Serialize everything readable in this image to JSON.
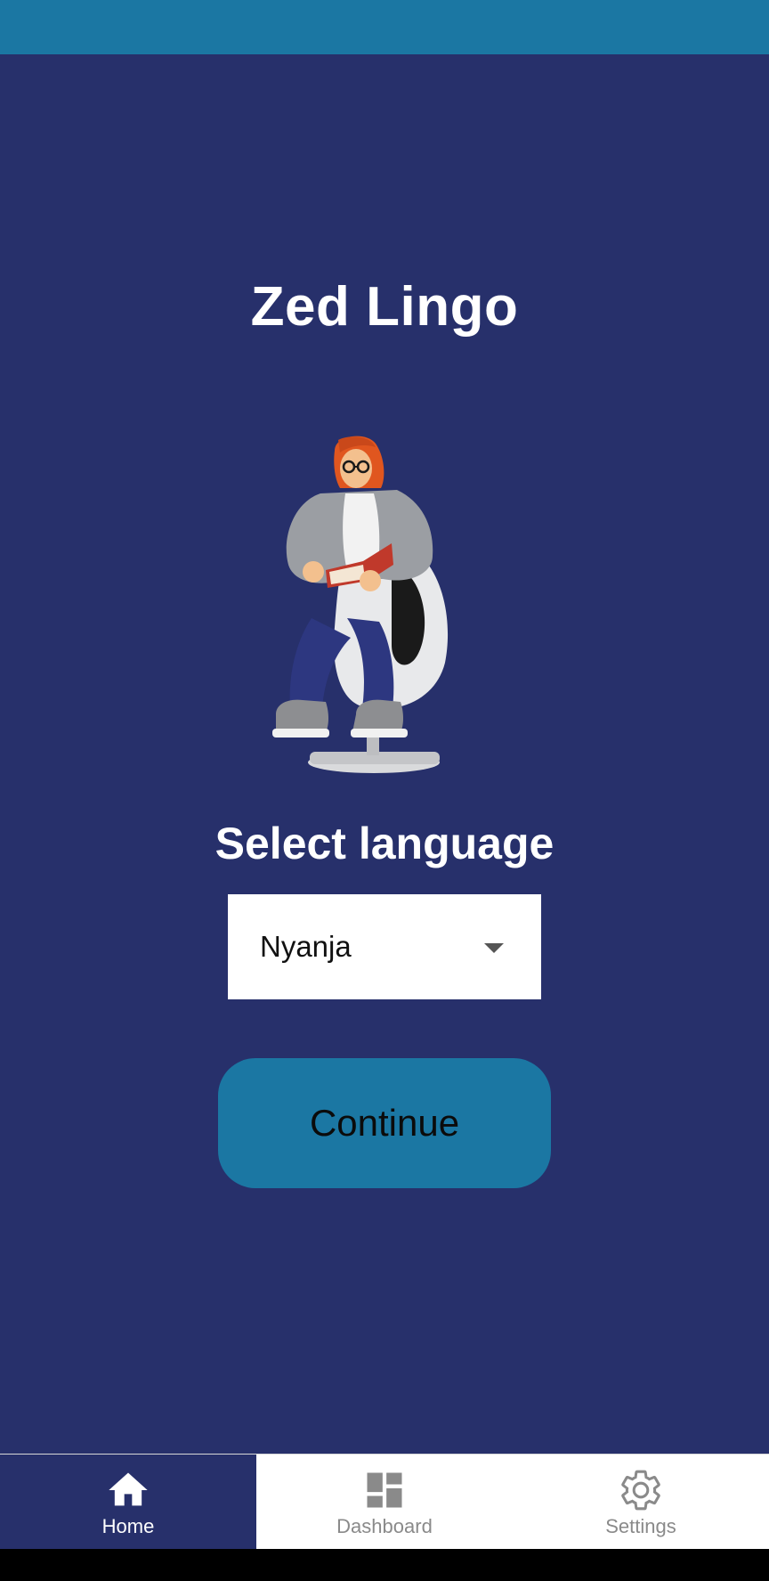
{
  "app": {
    "title": "Zed Lingo"
  },
  "main": {
    "select_heading": "Select language",
    "language_select": {
      "selected": "Nyanja"
    },
    "continue_label": "Continue"
  },
  "bottom_nav": {
    "items": [
      {
        "label": "Home",
        "icon": "home-icon",
        "active": true
      },
      {
        "label": "Dashboard",
        "icon": "dashboard-icon",
        "active": false
      },
      {
        "label": "Settings",
        "icon": "gear-icon",
        "active": false
      }
    ]
  },
  "colors": {
    "background": "#27306b",
    "accent": "#1b77a3",
    "surface": "#ffffff",
    "inactive": "#8a8a8a"
  }
}
